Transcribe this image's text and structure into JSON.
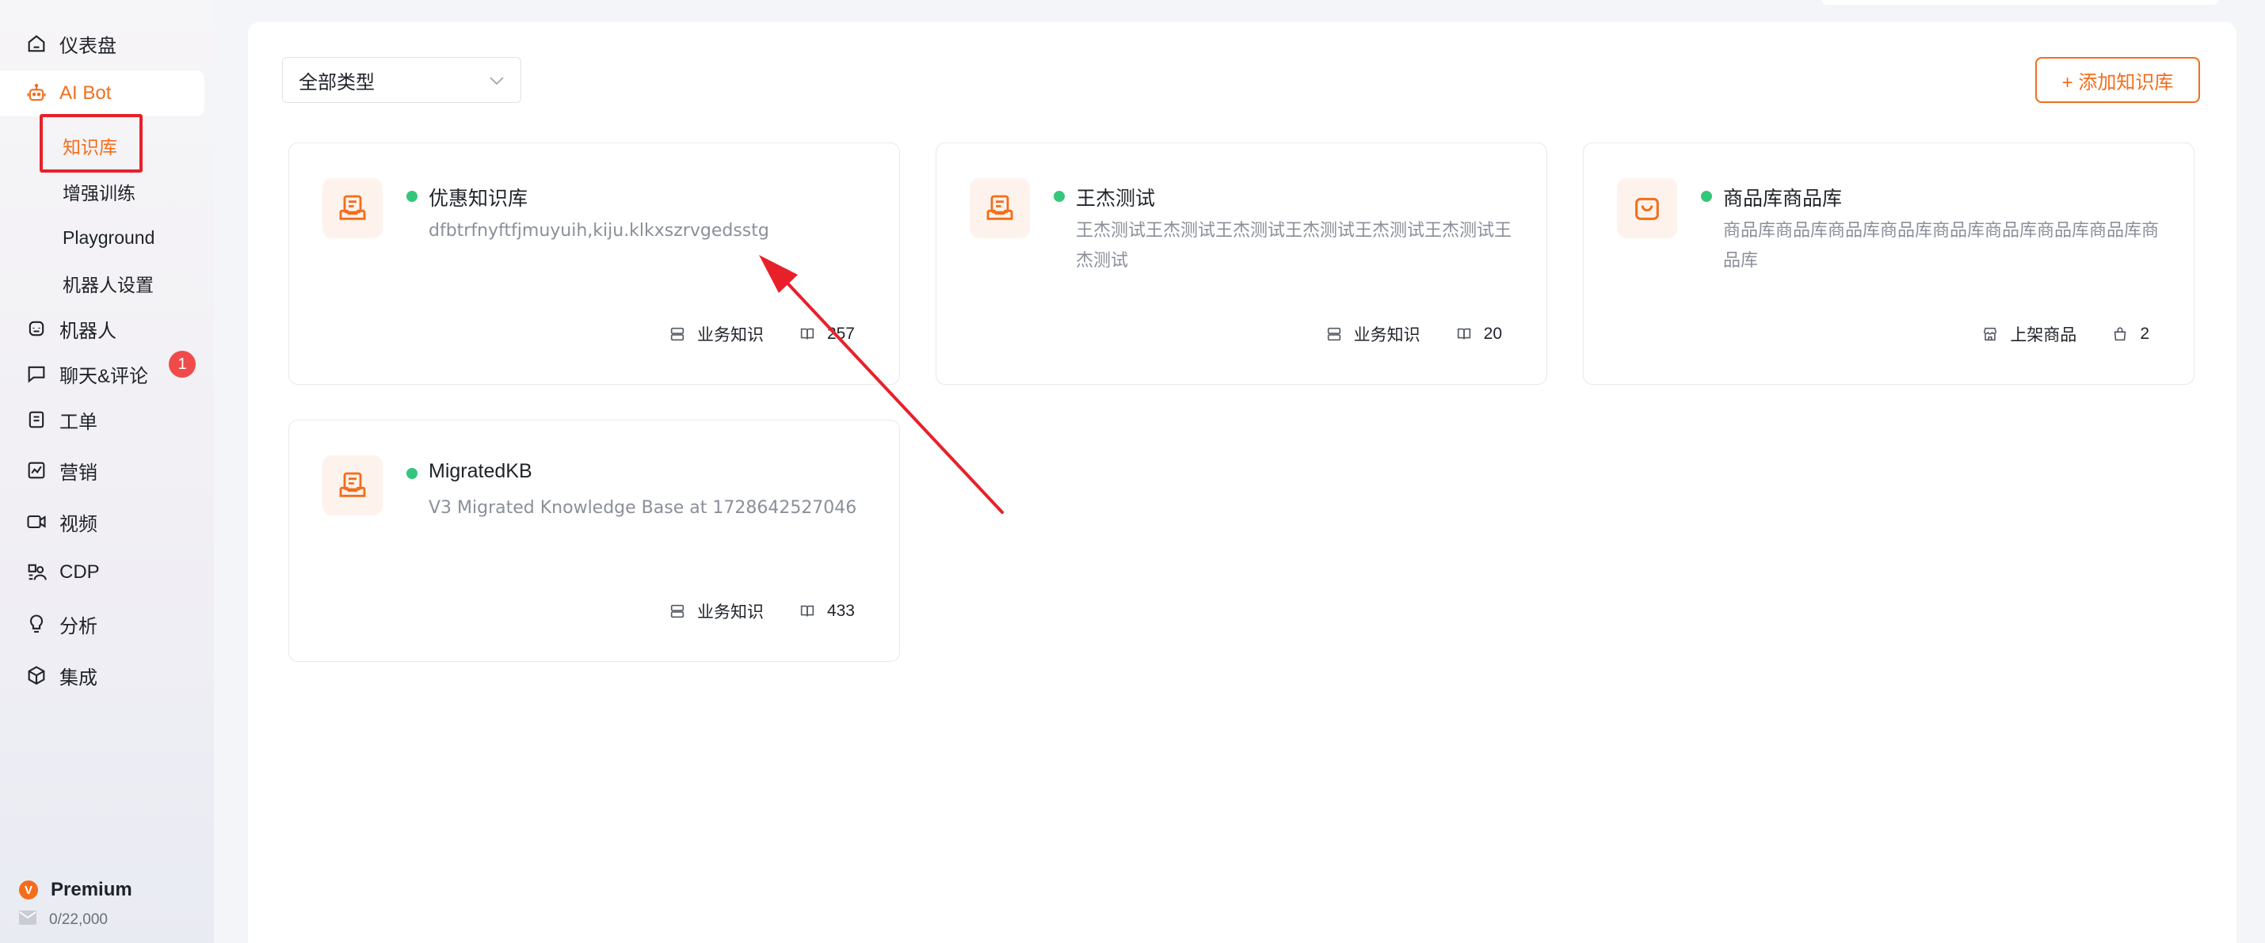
{
  "sidebar": {
    "items": [
      {
        "label": "仪表盘",
        "icon": "home-icon"
      },
      {
        "label": "AI Bot",
        "icon": "robot-icon"
      },
      {
        "label": "机器人",
        "icon": "bot-face-icon"
      },
      {
        "label": "聊天&评论",
        "icon": "chat-icon",
        "badge": "1"
      },
      {
        "label": "工单",
        "icon": "ticket-icon"
      },
      {
        "label": "营销",
        "icon": "chart-icon"
      },
      {
        "label": "视频",
        "icon": "video-icon"
      },
      {
        "label": "CDP",
        "icon": "people-icon"
      },
      {
        "label": "分析",
        "icon": "bulb-icon"
      },
      {
        "label": "集成",
        "icon": "cube-icon"
      }
    ],
    "sub_items": [
      "知识库",
      "增强训练",
      "Playground",
      "机器人设置"
    ],
    "plan": {
      "name": "Premium",
      "logo": "V",
      "quota": "0/22,000"
    }
  },
  "toolbar": {
    "type_filter": "全部类型",
    "add_label": "+ 添加知识库"
  },
  "cards": [
    {
      "title": "优惠知识库",
      "description": "dfbtrfnyftfjmuyuih,kiju.klkxszrvgedsstg",
      "meta": [
        {
          "icon": "database-icon",
          "label": "业务知识"
        },
        {
          "icon": "book-icon",
          "label": "257"
        }
      ]
    },
    {
      "title": "王杰测试",
      "description": "王杰测试王杰测试王杰测试王杰测试王杰测试王杰测试王杰测试",
      "meta": [
        {
          "icon": "database-icon",
          "label": "业务知识"
        },
        {
          "icon": "book-icon",
          "label": "20"
        }
      ]
    },
    {
      "title": "商品库商品库",
      "description": "商品库商品库商品库商品库商品库商品库商品库商品库商品库",
      "meta": [
        {
          "icon": "store-icon",
          "label": "上架商品"
        },
        {
          "icon": "bag-icon",
          "label": "2"
        }
      ]
    },
    {
      "title": "MigratedKB",
      "description": "V3 Migrated Knowledge Base at 1728642527046",
      "meta": [
        {
          "icon": "database-icon",
          "label": "业务知识"
        },
        {
          "icon": "book-icon",
          "label": "433"
        }
      ]
    }
  ],
  "colors": {
    "accent": "#f36d1c",
    "status_dot": "#34c77b",
    "annotation_red": "#e8202a"
  }
}
